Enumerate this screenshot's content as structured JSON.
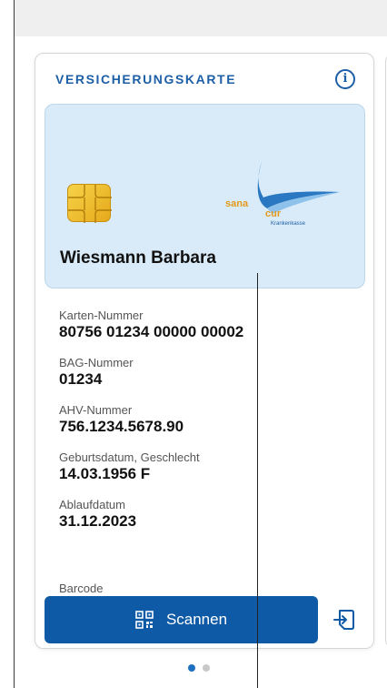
{
  "card": {
    "title": "VERSICHERUNGSKARTE",
    "holder_name": "Wiesmann Barbara",
    "logo_name": "sana cur",
    "logo_sub": "Krankenkasse"
  },
  "fields": [
    {
      "label": "Karten-Nummer",
      "value": "80756 01234 00000 00002"
    },
    {
      "label": "BAG-Nummer",
      "value": "01234"
    },
    {
      "label": "AHV-Nummer",
      "value": "756.1234.5678.90"
    },
    {
      "label": "Geburtsdatum, Geschlecht",
      "value": "14.03.1956 F"
    },
    {
      "label": "Ablaufdatum",
      "value": "31.12.2023"
    }
  ],
  "barcode_label": "Barcode",
  "scan_button": {
    "label": "Scannen"
  },
  "pager": {
    "count": 2,
    "active": 1
  },
  "colors": {
    "accent": "#0f5aa6",
    "card_bg": "#d9ebf8"
  }
}
